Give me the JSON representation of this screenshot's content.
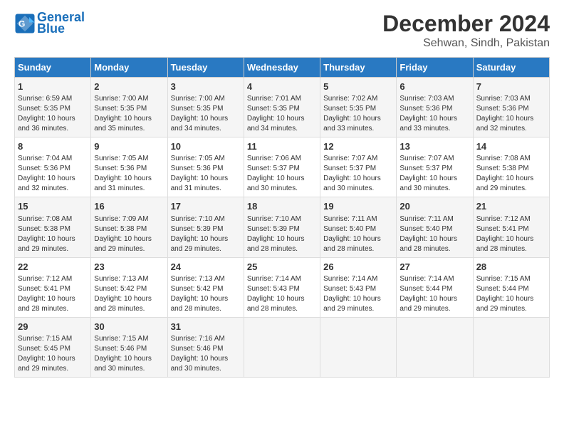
{
  "header": {
    "logo_line1": "General",
    "logo_line2": "Blue",
    "title": "December 2024",
    "subtitle": "Sehwan, Sindh, Pakistan"
  },
  "days_of_week": [
    "Sunday",
    "Monday",
    "Tuesday",
    "Wednesday",
    "Thursday",
    "Friday",
    "Saturday"
  ],
  "weeks": [
    [
      {
        "day": "1",
        "info": "Sunrise: 6:59 AM\nSunset: 5:35 PM\nDaylight: 10 hours\nand 36 minutes."
      },
      {
        "day": "2",
        "info": "Sunrise: 7:00 AM\nSunset: 5:35 PM\nDaylight: 10 hours\nand 35 minutes."
      },
      {
        "day": "3",
        "info": "Sunrise: 7:00 AM\nSunset: 5:35 PM\nDaylight: 10 hours\nand 34 minutes."
      },
      {
        "day": "4",
        "info": "Sunrise: 7:01 AM\nSunset: 5:35 PM\nDaylight: 10 hours\nand 34 minutes."
      },
      {
        "day": "5",
        "info": "Sunrise: 7:02 AM\nSunset: 5:35 PM\nDaylight: 10 hours\nand 33 minutes."
      },
      {
        "day": "6",
        "info": "Sunrise: 7:03 AM\nSunset: 5:36 PM\nDaylight: 10 hours\nand 33 minutes."
      },
      {
        "day": "7",
        "info": "Sunrise: 7:03 AM\nSunset: 5:36 PM\nDaylight: 10 hours\nand 32 minutes."
      }
    ],
    [
      {
        "day": "8",
        "info": "Sunrise: 7:04 AM\nSunset: 5:36 PM\nDaylight: 10 hours\nand 32 minutes."
      },
      {
        "day": "9",
        "info": "Sunrise: 7:05 AM\nSunset: 5:36 PM\nDaylight: 10 hours\nand 31 minutes."
      },
      {
        "day": "10",
        "info": "Sunrise: 7:05 AM\nSunset: 5:36 PM\nDaylight: 10 hours\nand 31 minutes."
      },
      {
        "day": "11",
        "info": "Sunrise: 7:06 AM\nSunset: 5:37 PM\nDaylight: 10 hours\nand 30 minutes."
      },
      {
        "day": "12",
        "info": "Sunrise: 7:07 AM\nSunset: 5:37 PM\nDaylight: 10 hours\nand 30 minutes."
      },
      {
        "day": "13",
        "info": "Sunrise: 7:07 AM\nSunset: 5:37 PM\nDaylight: 10 hours\nand 30 minutes."
      },
      {
        "day": "14",
        "info": "Sunrise: 7:08 AM\nSunset: 5:38 PM\nDaylight: 10 hours\nand 29 minutes."
      }
    ],
    [
      {
        "day": "15",
        "info": "Sunrise: 7:08 AM\nSunset: 5:38 PM\nDaylight: 10 hours\nand 29 minutes."
      },
      {
        "day": "16",
        "info": "Sunrise: 7:09 AM\nSunset: 5:38 PM\nDaylight: 10 hours\nand 29 minutes."
      },
      {
        "day": "17",
        "info": "Sunrise: 7:10 AM\nSunset: 5:39 PM\nDaylight: 10 hours\nand 29 minutes."
      },
      {
        "day": "18",
        "info": "Sunrise: 7:10 AM\nSunset: 5:39 PM\nDaylight: 10 hours\nand 28 minutes."
      },
      {
        "day": "19",
        "info": "Sunrise: 7:11 AM\nSunset: 5:40 PM\nDaylight: 10 hours\nand 28 minutes."
      },
      {
        "day": "20",
        "info": "Sunrise: 7:11 AM\nSunset: 5:40 PM\nDaylight: 10 hours\nand 28 minutes."
      },
      {
        "day": "21",
        "info": "Sunrise: 7:12 AM\nSunset: 5:41 PM\nDaylight: 10 hours\nand 28 minutes."
      }
    ],
    [
      {
        "day": "22",
        "info": "Sunrise: 7:12 AM\nSunset: 5:41 PM\nDaylight: 10 hours\nand 28 minutes."
      },
      {
        "day": "23",
        "info": "Sunrise: 7:13 AM\nSunset: 5:42 PM\nDaylight: 10 hours\nand 28 minutes."
      },
      {
        "day": "24",
        "info": "Sunrise: 7:13 AM\nSunset: 5:42 PM\nDaylight: 10 hours\nand 28 minutes."
      },
      {
        "day": "25",
        "info": "Sunrise: 7:14 AM\nSunset: 5:43 PM\nDaylight: 10 hours\nand 28 minutes."
      },
      {
        "day": "26",
        "info": "Sunrise: 7:14 AM\nSunset: 5:43 PM\nDaylight: 10 hours\nand 29 minutes."
      },
      {
        "day": "27",
        "info": "Sunrise: 7:14 AM\nSunset: 5:44 PM\nDaylight: 10 hours\nand 29 minutes."
      },
      {
        "day": "28",
        "info": "Sunrise: 7:15 AM\nSunset: 5:44 PM\nDaylight: 10 hours\nand 29 minutes."
      }
    ],
    [
      {
        "day": "29",
        "info": "Sunrise: 7:15 AM\nSunset: 5:45 PM\nDaylight: 10 hours\nand 29 minutes."
      },
      {
        "day": "30",
        "info": "Sunrise: 7:15 AM\nSunset: 5:46 PM\nDaylight: 10 hours\nand 30 minutes."
      },
      {
        "day": "31",
        "info": "Sunrise: 7:16 AM\nSunset: 5:46 PM\nDaylight: 10 hours\nand 30 minutes."
      },
      {
        "day": "",
        "info": ""
      },
      {
        "day": "",
        "info": ""
      },
      {
        "day": "",
        "info": ""
      },
      {
        "day": "",
        "info": ""
      }
    ]
  ]
}
